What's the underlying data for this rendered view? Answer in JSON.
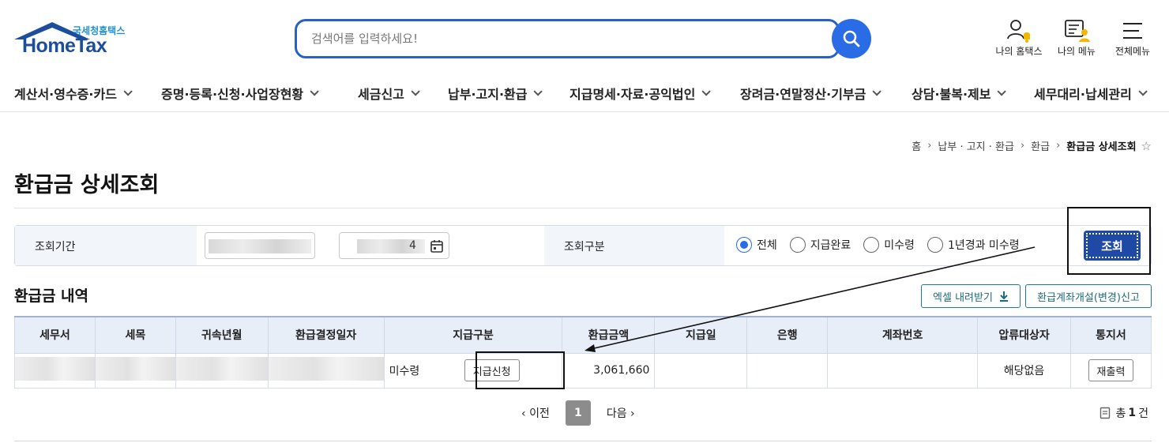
{
  "header": {
    "logo_sub": "국세청홈택스",
    "logo_main": "HomeTax",
    "search_placeholder": "검색어를 입력하세요!",
    "util": [
      "나의 홈택스",
      "나의 메뉴",
      "전체메뉴"
    ]
  },
  "nav": [
    "계산서·영수증·카드",
    "증명·등록·신청·사업장현황",
    "세금신고",
    "납부·고지·환급",
    "지급명세·자료·공익법인",
    "장려금·연말정산·기부금",
    "상담·불복·제보",
    "세무대리·납세관리"
  ],
  "breadcrumb": [
    "홈",
    "납부 · 고지 · 환급",
    "환급",
    "환급금 상세조회"
  ],
  "page_title": "환급금 상세조회",
  "filter": {
    "period_label": "조회기간",
    "date_to_tail": "4",
    "type_label": "조회구분",
    "options": [
      "전체",
      "지급완료",
      "미수령",
      "1년경과 미수령"
    ],
    "selected": "전체",
    "query_button": "조회"
  },
  "section": {
    "title": "환급금 내역",
    "excel_button": "엑셀 내려받기",
    "account_button": "환급계좌개설(변경)신고"
  },
  "table": {
    "headers": [
      "세무서",
      "세목",
      "귀속년월",
      "환급결정일자",
      "지급구분",
      "환급금액",
      "지급일",
      "은행",
      "계좌번호",
      "압류대상자",
      "통지서"
    ],
    "row": {
      "status": "미수령",
      "pay_button": "지급신청",
      "amount": "3,061,660",
      "seizure": "해당없음",
      "reprint_button": "재출력"
    }
  },
  "pager": {
    "prev": "이전",
    "page": "1",
    "next": "다음"
  },
  "total": {
    "prefix": "총",
    "count": "1",
    "suffix": "건"
  },
  "colors": {
    "accent": "#2a6be6",
    "brand": "#1c4e9c",
    "query": "#1e4aa6"
  }
}
